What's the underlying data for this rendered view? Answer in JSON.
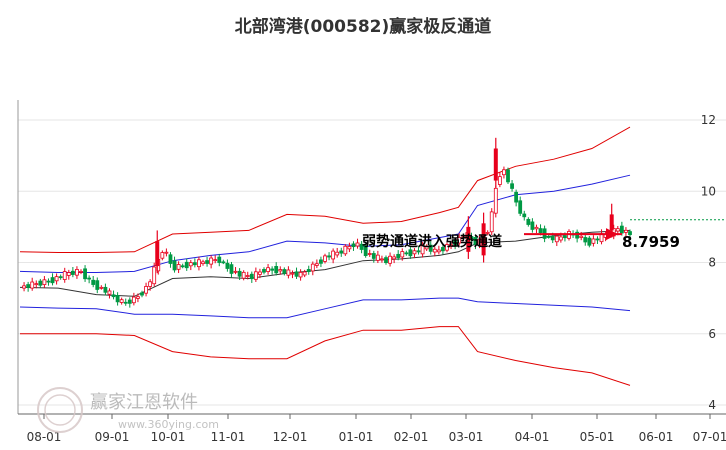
{
  "title": "北部湾港(000582)赢家极反通道",
  "watermark": {
    "name": "赢家江恩软件",
    "url": "www.360ying.com"
  },
  "colors": {
    "up": "#e8001c",
    "down": "#009944",
    "upper_band": "#e00000",
    "mid_band": "#2222dd",
    "baseline": "#333333",
    "price_line": "#009944",
    "marker": "#e8001c"
  },
  "chart_data": {
    "type": "candlestick-channel",
    "title": "北部湾港(000582)赢家极反通道",
    "x_ticks": [
      "08-01",
      "09-01",
      "10-01",
      "11-01",
      "12-01",
      "01-01",
      "02-01",
      "03-01",
      "04-01",
      "05-01",
      "06-01",
      "07-01"
    ],
    "y_ticks": [
      "12",
      "10",
      "8",
      "6",
      "4"
    ],
    "ylim": [
      4,
      12.6
    ],
    "grid": "horizontal",
    "annotation": "弱势通道进入强势通道",
    "last_price": "8.7959",
    "series": [
      {
        "name": "",
        "role": "outer-upper",
        "values": [
          [
            0,
            8.3
          ],
          [
            1,
            8.28
          ],
          [
            2,
            8.28
          ],
          [
            3,
            8.3
          ],
          [
            4,
            8.8
          ],
          [
            5,
            8.85
          ],
          [
            6,
            8.9
          ],
          [
            7,
            9.35
          ],
          [
            8,
            9.3
          ],
          [
            9,
            9.1
          ],
          [
            10,
            9.15
          ],
          [
            11,
            9.4
          ],
          [
            11.5,
            9.55
          ],
          [
            12,
            10.3
          ],
          [
            13,
            10.7
          ],
          [
            14,
            10.9
          ],
          [
            15,
            11.2
          ],
          [
            16,
            11.8
          ]
        ]
      },
      {
        "name": "",
        "role": "inner-upper",
        "values": [
          [
            0,
            7.75
          ],
          [
            1,
            7.72
          ],
          [
            2,
            7.72
          ],
          [
            3,
            7.75
          ],
          [
            4,
            8.05
          ],
          [
            5,
            8.2
          ],
          [
            6,
            8.3
          ],
          [
            7,
            8.6
          ],
          [
            8,
            8.55
          ],
          [
            9,
            8.45
          ],
          [
            10,
            8.5
          ],
          [
            11,
            8.7
          ],
          [
            11.5,
            8.8
          ],
          [
            12,
            9.6
          ],
          [
            13,
            9.9
          ],
          [
            14,
            10.0
          ],
          [
            15,
            10.2
          ],
          [
            16,
            10.45
          ]
        ]
      },
      {
        "name": "",
        "role": "baseline",
        "values": [
          [
            0,
            7.3
          ],
          [
            1,
            7.28
          ],
          [
            2,
            7.1
          ],
          [
            3,
            7.05
          ],
          [
            4,
            7.55
          ],
          [
            5,
            7.6
          ],
          [
            6,
            7.55
          ],
          [
            7,
            7.7
          ],
          [
            8,
            7.8
          ],
          [
            9,
            8.05
          ],
          [
            10,
            8.1
          ],
          [
            11,
            8.2
          ],
          [
            11.5,
            8.3
          ],
          [
            12,
            8.55
          ],
          [
            13,
            8.6
          ],
          [
            14,
            8.75
          ],
          [
            15,
            8.85
          ],
          [
            16,
            8.9
          ]
        ]
      },
      {
        "name": "",
        "role": "inner-lower",
        "values": [
          [
            0,
            6.75
          ],
          [
            1,
            6.72
          ],
          [
            2,
            6.7
          ],
          [
            3,
            6.55
          ],
          [
            4,
            6.55
          ],
          [
            5,
            6.5
          ],
          [
            6,
            6.45
          ],
          [
            7,
            6.45
          ],
          [
            8,
            6.7
          ],
          [
            9,
            6.95
          ],
          [
            10,
            6.95
          ],
          [
            11,
            7.0
          ],
          [
            11.5,
            7.0
          ],
          [
            12,
            6.9
          ],
          [
            13,
            6.85
          ],
          [
            14,
            6.8
          ],
          [
            15,
            6.75
          ],
          [
            16,
            6.65
          ]
        ]
      },
      {
        "name": "",
        "role": "outer-lower",
        "values": [
          [
            0,
            6.0
          ],
          [
            1,
            6.0
          ],
          [
            2,
            6.0
          ],
          [
            3,
            5.95
          ],
          [
            4,
            5.5
          ],
          [
            5,
            5.35
          ],
          [
            6,
            5.3
          ],
          [
            7,
            5.3
          ],
          [
            8,
            5.8
          ],
          [
            9,
            6.1
          ],
          [
            10,
            6.1
          ],
          [
            11,
            6.2
          ],
          [
            11.5,
            6.2
          ],
          [
            12,
            5.5
          ],
          [
            13,
            5.25
          ],
          [
            14,
            5.05
          ],
          [
            15,
            4.9
          ],
          [
            16,
            4.55
          ]
        ]
      }
    ],
    "price_path": [
      [
        0,
        7.3
      ],
      [
        0.5,
        7.4
      ],
      [
        1,
        7.5
      ],
      [
        1.3,
        7.6
      ],
      [
        1.6,
        7.7
      ],
      [
        2,
        7.75
      ],
      [
        2.3,
        7.45
      ],
      [
        2.8,
        7.2
      ],
      [
        3.1,
        7.0
      ],
      [
        3.4,
        6.85
      ],
      [
        3.8,
        7.0
      ],
      [
        4.2,
        7.35
      ],
      [
        4.5,
        8.0
      ],
      [
        4.7,
        8.4
      ],
      [
        5,
        7.85
      ],
      [
        5.5,
        7.95
      ],
      [
        6,
        8.0
      ],
      [
        6.5,
        8.1
      ],
      [
        6.8,
        7.85
      ],
      [
        7.2,
        7.65
      ],
      [
        7.6,
        7.6
      ],
      [
        8,
        7.8
      ],
      [
        8.4,
        7.8
      ],
      [
        8.8,
        7.7
      ],
      [
        9.2,
        7.65
      ],
      [
        9.6,
        7.9
      ],
      [
        10,
        8.15
      ],
      [
        10.5,
        8.3
      ],
      [
        11,
        8.55
      ],
      [
        11.3,
        8.3
      ],
      [
        11.6,
        8.15
      ],
      [
        12,
        8.05
      ],
      [
        12.5,
        8.25
      ],
      [
        13,
        8.3
      ],
      [
        13.3,
        8.45
      ],
      [
        13.6,
        8.3
      ],
      [
        14,
        8.45
      ],
      [
        14.3,
        8.6
      ],
      [
        14.6,
        8.8
      ],
      [
        15,
        8.5
      ],
      [
        15.2,
        8.75
      ],
      [
        15.4,
        9.0
      ],
      [
        15.6,
        10.1
      ],
      [
        15.8,
        10.7
      ],
      [
        16,
        10.3
      ],
      [
        16.3,
        9.6
      ],
      [
        16.6,
        9.1
      ],
      [
        17,
        8.9
      ],
      [
        17.3,
        8.7
      ],
      [
        17.6,
        8.65
      ],
      [
        18,
        8.8
      ],
      [
        18.3,
        8.75
      ],
      [
        18.6,
        8.55
      ],
      [
        19,
        8.7
      ],
      [
        19.3,
        8.8
      ],
      [
        19.6,
        8.95
      ],
      [
        20,
        8.8
      ]
    ],
    "spike_candles": [
      [
        15.6,
        10.1,
        11.5
      ],
      [
        15.2,
        8.0,
        9.4
      ],
      [
        14.7,
        8.1,
        9.3
      ],
      [
        19.4,
        8.7,
        9.65
      ],
      [
        4.5,
        7.7,
        8.9
      ]
    ]
  }
}
